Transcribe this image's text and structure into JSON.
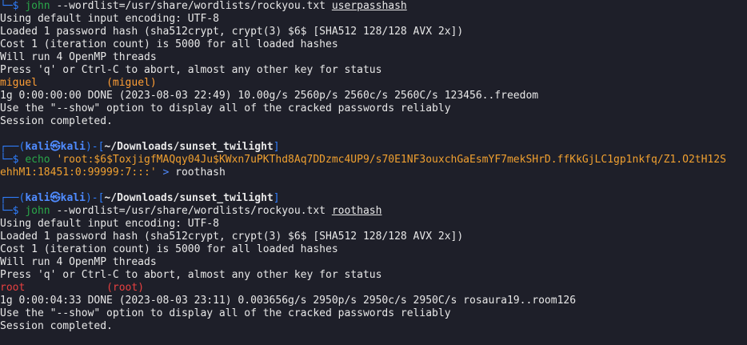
{
  "block1": {
    "prompt_tail": "└─$",
    "cmd_name": "john",
    "cmd_args": "--wordlist=/usr/share/wordlists/rockyou.txt",
    "cmd_file": "userpasshash",
    "output": [
      "Using default input encoding: UTF-8",
      "Loaded 1 password hash (sha512crypt, crypt(3) $6$ [SHA512 128/128 AVX 2x])",
      "Cost 1 (iteration count) is 5000 for all loaded hashes",
      "Will run 4 OpenMP threads",
      "Press 'q' or Ctrl-C to abort, almost any other key for status"
    ],
    "cracked_password": "miguel",
    "cracked_user": "(miguel)",
    "stats": "1g 0:00:00:00 DONE (2023-08-03 22:49) 10.00g/s 2560p/s 2560c/s 2560C/s 123456..freedom",
    "show_hint": "Use the \"--show\" option to display all of the cracked passwords reliably",
    "session": "Session completed."
  },
  "block2": {
    "prompt_head_open": "┌──(",
    "user_host": "kali㉿kali",
    "prompt_head_mid": ")-[",
    "path": "~/Downloads/sunset_twilight",
    "prompt_head_close": "]",
    "prompt_tail": "└─$",
    "cmd_name": "echo",
    "string_part1": "'root:$6$ToxjigfMAQqy04Ju$KWxn7uPKThd8Aq7DDzmc4UP9/s70E1NF3ouxchGaEsmYF7mekSHrD.ffKkGjLC1gp1nkfq/Z1.O2tH12S",
    "string_part2": "ehhM1:18451:0:99999:7:::'",
    "redirect": ">",
    "target": "roothash"
  },
  "block3": {
    "prompt_head_open": "┌──(",
    "user_host": "kali㉿kali",
    "prompt_head_mid": ")-[",
    "path": "~/Downloads/sunset_twilight",
    "prompt_head_close": "]",
    "prompt_tail": "└─$",
    "cmd_name": "john",
    "cmd_args": "--wordlist=/usr/share/wordlists/rockyou.txt",
    "cmd_file": "roothash",
    "output": [
      "Using default input encoding: UTF-8",
      "Loaded 1 password hash (sha512crypt, crypt(3) $6$ [SHA512 128/128 AVX 2x])",
      "Cost 1 (iteration count) is 5000 for all loaded hashes",
      "Will run 4 OpenMP threads",
      "Press 'q' or Ctrl-C to abort, almost any other key for status"
    ],
    "cracked_password": "root",
    "cracked_user": "(root)",
    "stats": "1g 0:00:04:33 DONE (2023-08-03 23:11) 0.003656g/s 2950p/s 2950c/s 2950C/s rosaura19..room126",
    "show_hint": "Use the \"--show\" option to display all of the cracked passwords reliably",
    "session": "Session completed."
  },
  "colors": {
    "background": "#1e1f29",
    "prompt_blue": "#2f7fff",
    "command_green": "#2aa84a",
    "password_orange": "#ff9e35",
    "password_red": "#e84040"
  }
}
